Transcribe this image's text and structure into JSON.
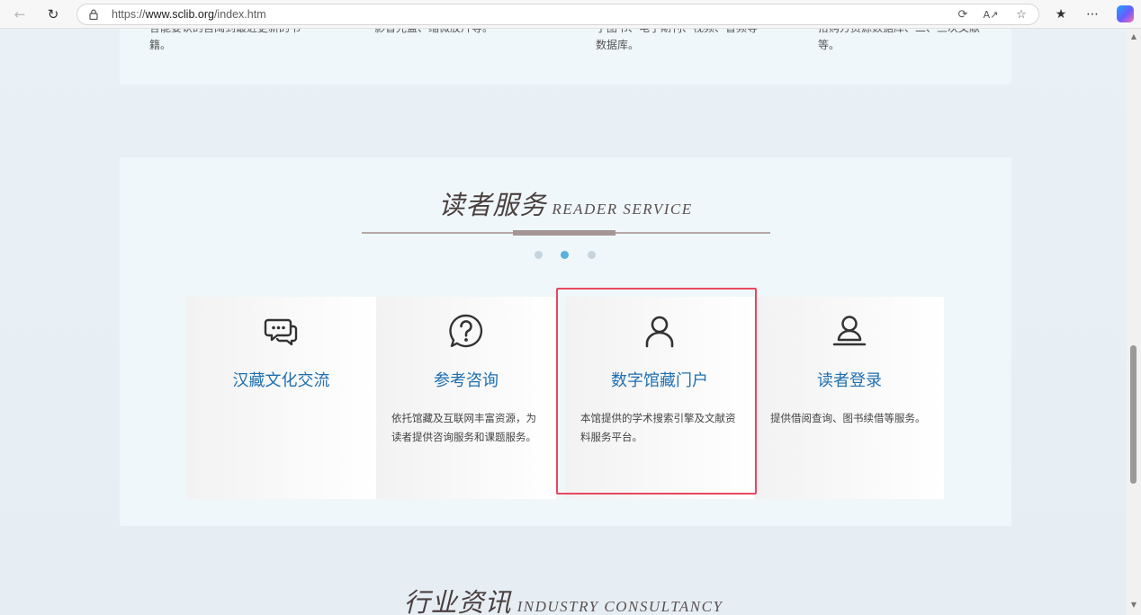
{
  "browser": {
    "url_prefix": "https://",
    "url_host": "www.sclib.org",
    "url_path": "/index.htm"
  },
  "top_panel": {
    "columns": [
      "各能要认的宫阔到最近更新的书籍。",
      "影音光盘、缩微胶片等。",
      "子图书、电子期刊、视频、音频等数据库。",
      "拾购方资源数据库、二、三次文献等。"
    ]
  },
  "reader_service": {
    "title_cn": "读者服务",
    "title_en": "READER SERVICE",
    "carousel_active_index": 1,
    "carousel_count": 3,
    "cards": [
      {
        "icon": "chat-bubbles-icon",
        "name": "汉藏文化交流",
        "desc": ""
      },
      {
        "icon": "question-circle-icon",
        "name": "参考咨询",
        "desc": "依托馆藏及互联网丰富资源，为读者提供咨询服务和课题服务。"
      },
      {
        "icon": "user-icon",
        "name": "数字馆藏门户",
        "desc": "本馆提供的学术搜索引擎及文献资料服务平台。"
      },
      {
        "icon": "user-login-icon",
        "name": "读者登录",
        "desc": "提供借阅查询、图书续借等服务。"
      }
    ]
  },
  "industry": {
    "title_cn": "行业资讯",
    "title_en": "INDUSTRY CONSULTANCY"
  },
  "colors": {
    "card_title": "#1f6fb0",
    "highlight_border": "#e8475f",
    "active_dot": "#58b2df"
  }
}
